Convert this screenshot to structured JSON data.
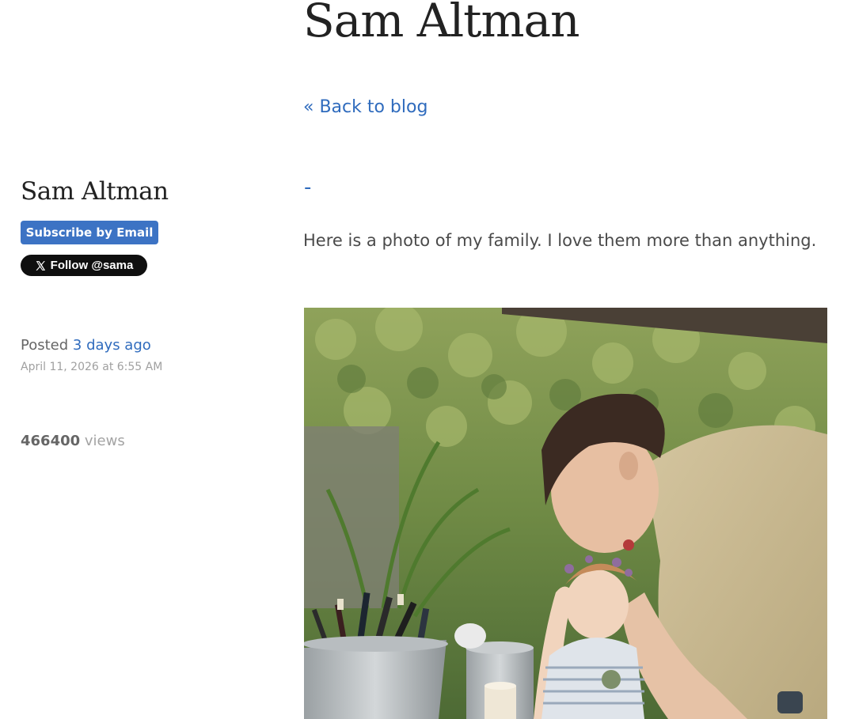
{
  "header": {
    "title": "Sam Altman",
    "back_link": "« Back to blog"
  },
  "sidebar": {
    "name": "Sam Altman",
    "subscribe_label": "Subscribe by Email",
    "follow_label": "Follow @sama",
    "posted_prefix": "Posted",
    "posted_relative": "3 days ago",
    "posted_date": "April 11, 2026 at 6:55 AM",
    "views_count": "466400",
    "views_suffix": "views"
  },
  "post": {
    "title": "-",
    "body": "Here is a photo of my family. I love them more than anything.",
    "photo_icon": "family-photo"
  },
  "colors": {
    "link": "#2f6bbd",
    "subscribe_button": "#3c73c4",
    "follow_button": "#0f0f0f"
  }
}
